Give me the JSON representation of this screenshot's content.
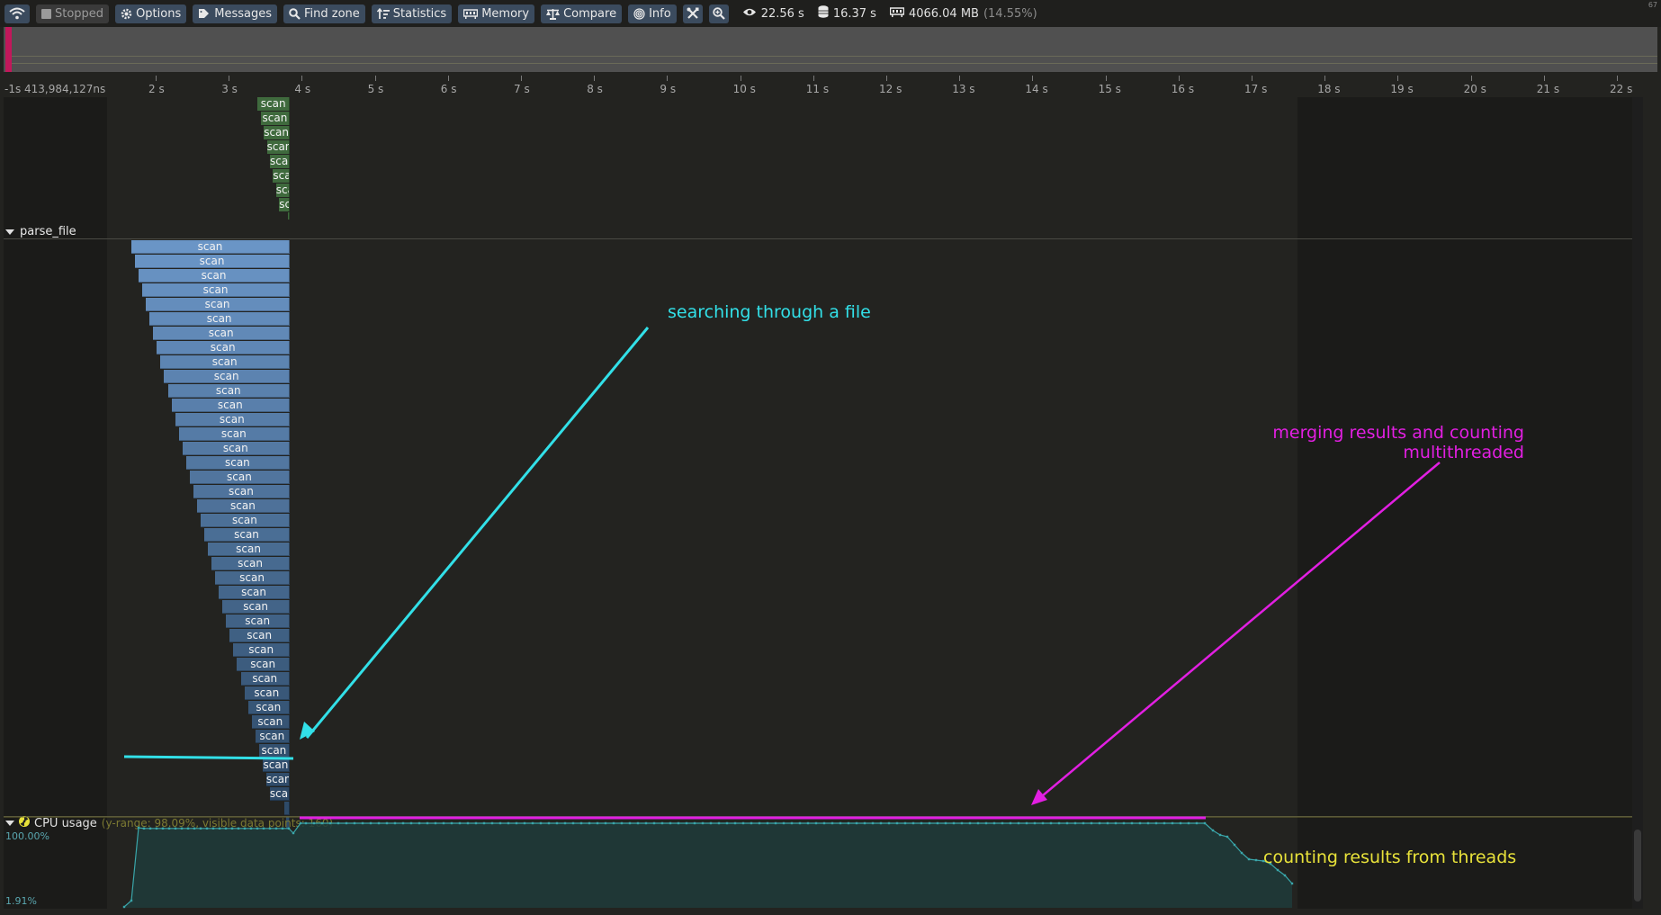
{
  "toolbar": {
    "connection_icon": "wifi-icon",
    "stopped_label": "Stopped",
    "options_label": "Options",
    "messages_label": "Messages",
    "find_zone_label": "Find zone",
    "statistics_label": "Statistics",
    "memory_label": "Memory",
    "compare_label": "Compare",
    "info_label": "Info",
    "tools_icon": "wrench-screwdriver-icon",
    "zoom_icon": "magnifier-plus-icon",
    "view_time": "22.56 s",
    "total_time": "16.37 s",
    "memory_usage": "4066.04 MB",
    "memory_percent": "(14.55%)",
    "fps": "67"
  },
  "ruler": {
    "offset_label": "-1s 413,984,127ns",
    "ticks": [
      "2 s",
      "3 s",
      "4 s",
      "5 s",
      "6 s",
      "7 s",
      "8 s",
      "9 s",
      "10 s",
      "11 s",
      "12 s",
      "13 s",
      "14 s",
      "15 s",
      "16 s",
      "17 s",
      "18 s",
      "19 s",
      "20 s",
      "21 s",
      "22 s"
    ]
  },
  "threads": {
    "parse_file_label": "parse_file",
    "zone_label": "scan"
  },
  "cpu": {
    "title": "CPU usage",
    "meta": "(y-range: 98.09%, visible data points: 160)",
    "top_label": "100.00%",
    "bottom_label": "1.91%"
  },
  "annotations": {
    "searching": "searching through a file",
    "merging_line1": "merging results and counting",
    "merging_line2": "multithreaded",
    "counting": "counting results from threads"
  },
  "colors": {
    "cyan": "#32e0e8",
    "magenta": "#e21fe2",
    "yellow": "#e8e23a",
    "zone_blue_top": "#6a95c6",
    "zone_blue_bottom": "#2e4a68",
    "zone_green": "#3f6a3d"
  }
}
